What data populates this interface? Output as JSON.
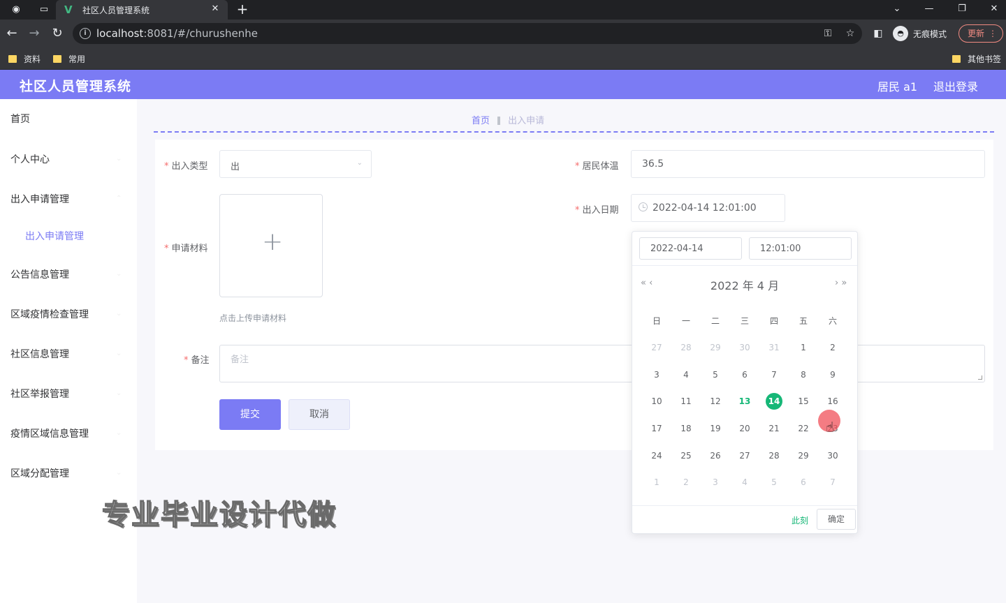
{
  "browser": {
    "tab_title": "社区人员管理系统",
    "url_host": "localhost",
    "url_rest": ":8081/#/churushenhe",
    "profile_label": "无痕模式",
    "update_label": "更新",
    "bookmarks": [
      "资料",
      "常用"
    ],
    "other_bookmarks": "其他书签"
  },
  "header": {
    "title": "社区人员管理系统",
    "user": "居民 a1",
    "logout": "退出登录"
  },
  "sidebar": {
    "items": [
      "首页",
      "个人中心",
      "出入申请管理",
      "出入申请管理",
      "公告信息管理",
      "区域疫情检查管理",
      "社区信息管理",
      "社区举报管理",
      "疫情区域信息管理",
      "区域分配管理"
    ]
  },
  "breadcrumb": {
    "home": "首页",
    "current": "出入申请"
  },
  "form": {
    "type_label": "出入类型",
    "type_value": "出",
    "temp_label": "居民体温",
    "temp_value": "36.5",
    "date_label": "出入日期",
    "date_value": "2022-04-14 12:01:00",
    "material_label": "申请材料",
    "upload_tip": "点击上传申请材料",
    "remark_label": "备注",
    "remark_placeholder": "备注",
    "submit": "提交",
    "cancel": "取消"
  },
  "picker": {
    "date_input": "2022-04-14",
    "time_input": "12:01:00",
    "month_label": "2022 年  4 月",
    "prev": "« ‹",
    "next": "› »",
    "weekdays": [
      "日",
      "一",
      "二",
      "三",
      "四",
      "五",
      "六"
    ],
    "weeks": [
      [
        "27",
        "28",
        "29",
        "30",
        "31",
        "1",
        "2"
      ],
      [
        "3",
        "4",
        "5",
        "6",
        "7",
        "8",
        "9"
      ],
      [
        "10",
        "11",
        "12",
        "13",
        "14",
        "15",
        "16"
      ],
      [
        "17",
        "18",
        "19",
        "20",
        "21",
        "22",
        "23"
      ],
      [
        "24",
        "25",
        "26",
        "27",
        "28",
        "29",
        "30"
      ],
      [
        "1",
        "2",
        "3",
        "4",
        "5",
        "6",
        "7"
      ]
    ],
    "today": "13",
    "selected": "14",
    "now_label": "此刻",
    "ok_label": "确定"
  },
  "watermark": "专业毕业设计代做",
  "colors": {
    "accent": "#7b7bf4",
    "picker_green": "#16b777"
  }
}
